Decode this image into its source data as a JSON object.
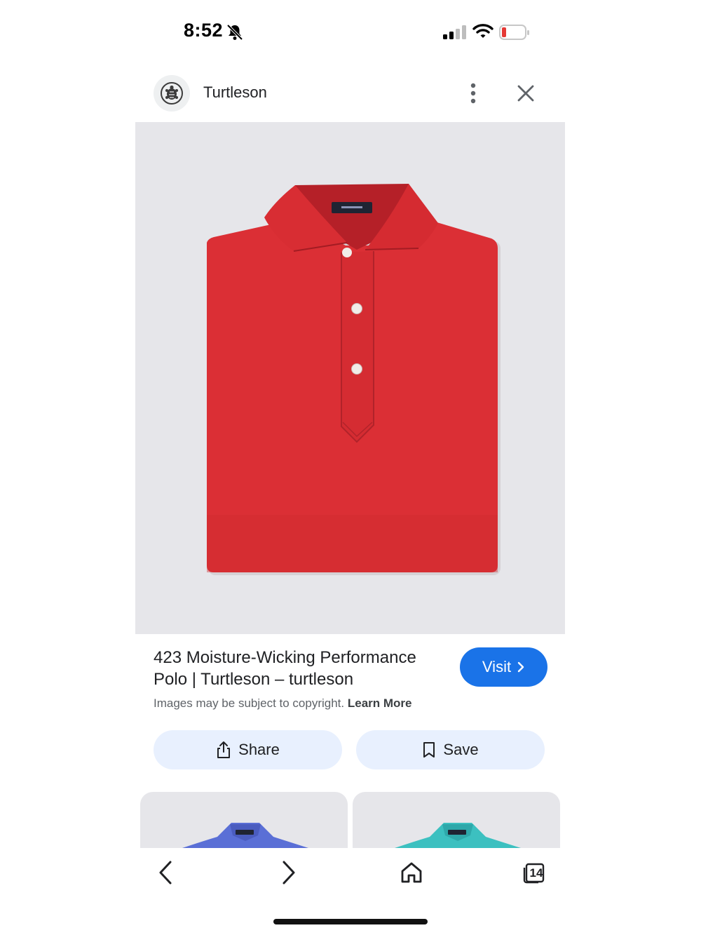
{
  "status_bar": {
    "time": "8:52",
    "icons": [
      "bell-slash-icon",
      "cellular-signal-icon",
      "wifi-icon",
      "battery-low-icon"
    ],
    "battery_color": "#e53935"
  },
  "header": {
    "source_name": "Turtleson",
    "logo_icon": "turtle-logo-icon",
    "more_icon": "more-vertical-icon",
    "close_icon": "close-icon"
  },
  "main_image": {
    "subject": "red polo shirt",
    "background_color": "#e6e6ea",
    "shirt_color": "#db2f35"
  },
  "caption": {
    "title": "423 Moisture-Wicking Performance Polo | Turtleson – turtleson",
    "copyright_text": "Images may be subject to copyright.",
    "learn_more": "Learn More"
  },
  "visit_button": {
    "label": "Visit",
    "icon": "chevron-right-icon",
    "color": "#1a73e8"
  },
  "actions": {
    "share_label": "Share",
    "share_icon": "share-icon",
    "save_label": "Save",
    "save_icon": "bookmark-icon",
    "button_color": "#e8f0fe"
  },
  "related_images": [
    {
      "subject": "blue polo shirt",
      "shirt_color": "#5a6fd6"
    },
    {
      "subject": "teal polo shirt",
      "shirt_color": "#3cc0c0"
    }
  ],
  "bottom_nav": {
    "back_icon": "chevron-left-icon",
    "forward_icon": "chevron-right-icon",
    "home_icon": "home-icon",
    "tabs_icon": "tabs-icon",
    "tab_count": "14"
  }
}
